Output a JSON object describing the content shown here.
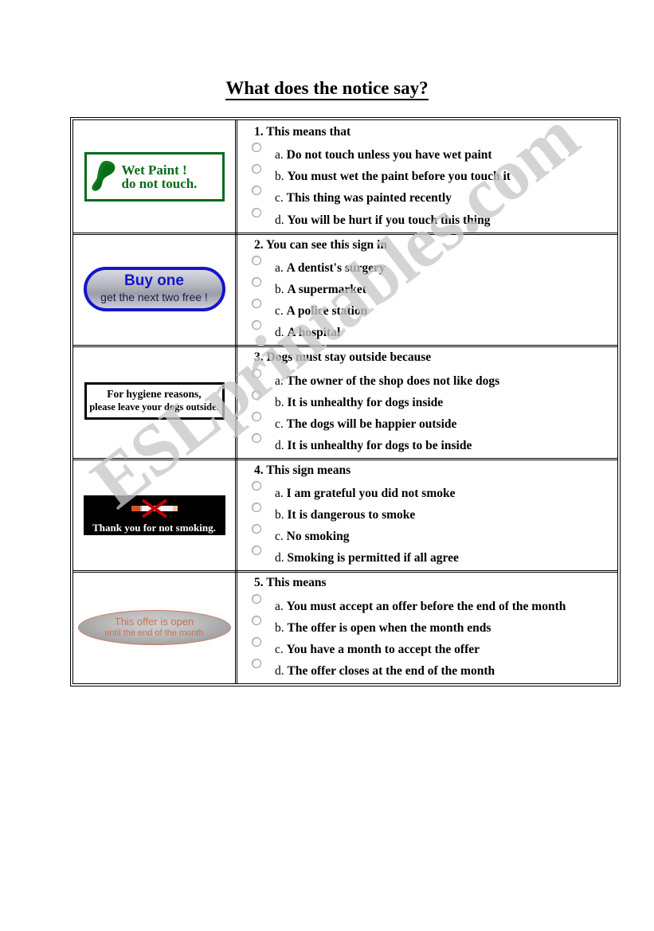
{
  "watermark": {
    "text": "ESLprintables.com"
  },
  "title": {
    "text": "What does the notice say?"
  },
  "colors": {
    "wet_paint_green": "#0a6b18",
    "buy_one_blue": "#1414cd",
    "offer_salmon": "#c9705a",
    "smoking_black": "#000000",
    "watermark_gray": "#c8c8c8"
  },
  "questions": [
    {
      "number": "1.",
      "stem": "1. This means that",
      "sign": {
        "name": "wet-paint-sign",
        "line1": "Wet Paint !",
        "line2": "do not touch.",
        "icon": "paint-blob-icon"
      },
      "options": [
        {
          "letter": "a.",
          "text": "Do not touch unless you have wet paint"
        },
        {
          "letter": "b.",
          "text": "You must wet the paint before you touch it"
        },
        {
          "letter": "c.",
          "text": "This thing was painted recently"
        },
        {
          "letter": "d.",
          "text": "You will be hurt if you touch this thing"
        }
      ]
    },
    {
      "number": "2.",
      "stem": "2. You can see this sign in",
      "sign": {
        "name": "buy-one-sign",
        "line1": "Buy one",
        "line2": "get the next two free !"
      },
      "options": [
        {
          "letter": "a.",
          "text": "A dentist's surgery"
        },
        {
          "letter": "b.",
          "text": "A supermarket"
        },
        {
          "letter": "c.",
          "text": "A police station"
        },
        {
          "letter": "d.",
          "text": "A hospital"
        }
      ]
    },
    {
      "number": "3.",
      "stem": "3. Dogs must stay outside because",
      "sign": {
        "name": "hygiene-dogs-sign",
        "line1": "For hygiene reasons,",
        "line2": "please leave your dogs outside."
      },
      "options": [
        {
          "letter": "a.",
          "text": "The owner of the shop does not like dogs"
        },
        {
          "letter": "b.",
          "text": "It is unhealthy for dogs inside"
        },
        {
          "letter": "c.",
          "text": "The dogs will be happier outside"
        },
        {
          "letter": "d.",
          "text": "It is unhealthy for dogs to be inside"
        }
      ]
    },
    {
      "number": "4.",
      "stem": "4. This sign means",
      "sign": {
        "name": "no-smoking-sign",
        "line1": "Thank you for not smoking.",
        "icon": "crossed-cigarette-icon"
      },
      "options": [
        {
          "letter": "a.",
          "text": "I am grateful you did not smoke"
        },
        {
          "letter": "b.",
          "text": "It is dangerous to smoke"
        },
        {
          "letter": "c.",
          "text": "No smoking"
        },
        {
          "letter": "d.",
          "text": "Smoking is permitted if all agree"
        }
      ]
    },
    {
      "number": "5.",
      "stem": "5. This means",
      "sign": {
        "name": "offer-open-sign",
        "line1": "This offer is open",
        "line2": "until the end of the month"
      },
      "options": [
        {
          "letter": "a.",
          "text": "You must accept an offer before the end of the month"
        },
        {
          "letter": "b.",
          "text": "The offer is open when the month ends"
        },
        {
          "letter": "c.",
          "text": "You have a month to accept the offer"
        },
        {
          "letter": "d.",
          "text": "The offer closes at the end of the month"
        }
      ]
    }
  ]
}
